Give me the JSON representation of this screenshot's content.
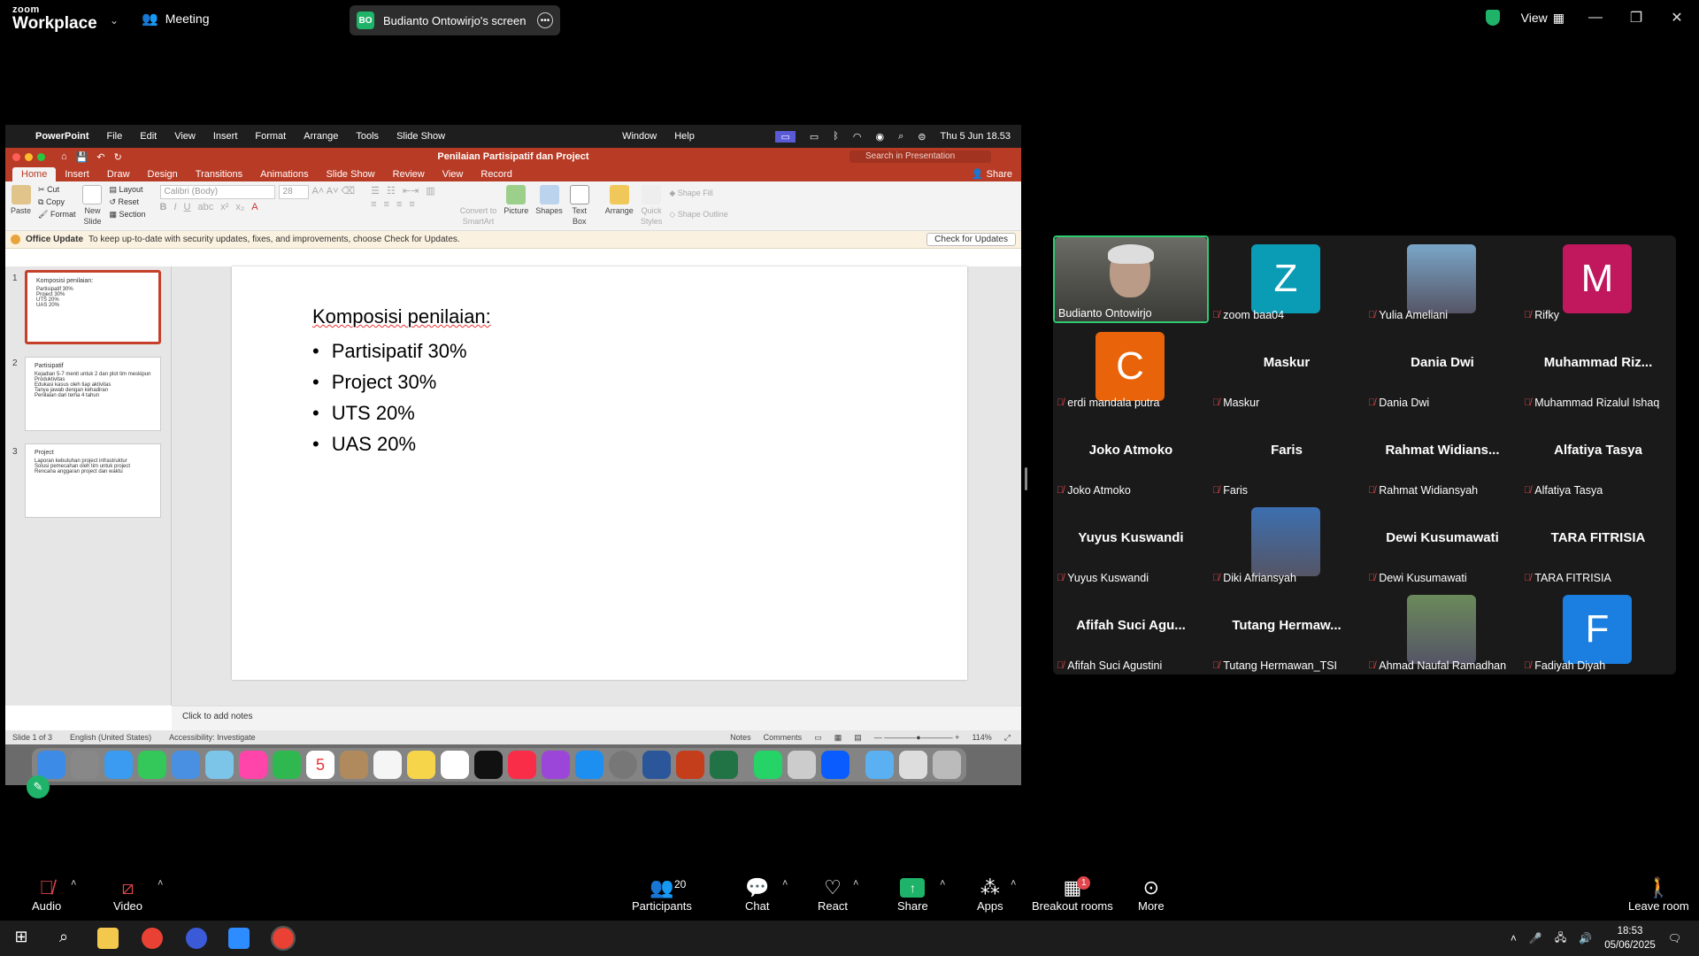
{
  "zoom": {
    "logo_top": "zoom",
    "logo_bottom": "Workplace",
    "meeting_label": "Meeting",
    "share_initials": "BO",
    "share_label": "Budianto Ontowirjo's screen",
    "view_label": "View",
    "accent": "#1fb36a"
  },
  "mac": {
    "app": "PowerPoint",
    "menus": [
      "File",
      "Edit",
      "View",
      "Insert",
      "Format",
      "Arrange",
      "Tools",
      "Slide Show"
    ],
    "menus_right": [
      "Window",
      "Help"
    ],
    "datetime": "Thu 5 Jun  18.53"
  },
  "ppt": {
    "doc_title": "Penilaian Partisipatif dan Project",
    "search_placeholder": "Search in Presentation",
    "share_label": "Share",
    "tabs": [
      "Home",
      "Insert",
      "Draw",
      "Design",
      "Transitions",
      "Animations",
      "Slide Show",
      "Review",
      "View",
      "Record"
    ],
    "brand_color": "#b83b26",
    "ribbon": {
      "paste": "Paste",
      "cut": "Cut",
      "copy": "Copy",
      "format": "Format",
      "new_slide_1": "New",
      "new_slide_2": "Slide",
      "layout": "Layout",
      "reset": "Reset",
      "section": "Section",
      "font": "Calibri (Body)",
      "size": "28",
      "convert_1": "Convert to",
      "convert_2": "SmartArt",
      "picture": "Picture",
      "shapes": "Shapes",
      "textbox_1": "Text",
      "textbox_2": "Box",
      "arrange": "Arrange",
      "quick_1": "Quick",
      "quick_2": "Styles",
      "shape_fill": "Shape Fill",
      "shape_outline": "Shape Outline"
    },
    "update_title": "Office Update",
    "update_text": "To keep up-to-date with security updates, fixes, and improvements, choose Check for Updates.",
    "check_btn": "Check for Updates",
    "thumbs": [
      {
        "num": "1",
        "title": "Komposisi penilaian:",
        "lines": [
          "Partisipatif 30%",
          "Project 30%",
          "UTS 20%",
          "UAS 20%"
        ]
      },
      {
        "num": "2",
        "title": "Partisipatif",
        "lines": [
          "Kejadian 5-7 menit untuk 2 dan plot tim meskipun",
          "Produktivitas",
          "Edukasi kasus oleh tiap aktivitas",
          "Tanya jawab dengan kehadiran",
          "Penilaian dari tema 4 tahun"
        ]
      },
      {
        "num": "3",
        "title": "Project",
        "lines": [
          "Laporan kebutuhan project infrastruktur",
          "Solusi pemecahan oleh tim untuk project",
          "Rencana anggaran project dan waktu"
        ]
      }
    ],
    "slide_title": "Komposisi penilaian:",
    "slide_bullets": [
      "Partisipatif 30%",
      "Project 30%",
      "UTS 20%",
      "UAS 20%"
    ],
    "notes_placeholder": "Click to add notes",
    "status_slide": "Slide 1 of 3",
    "status_lang": "English (United States)",
    "status_access": "Accessibility: Investigate",
    "status_notes": "Notes",
    "status_comments": "Comments",
    "zoom_level": "114%",
    "dock_date": "5"
  },
  "participants": [
    {
      "center": "",
      "label": "Budianto Ontowirjo",
      "muted": false,
      "kind": "video"
    },
    {
      "center": "",
      "label": "zoom baa04",
      "muted": true,
      "kind": "avatar",
      "letter": "Z",
      "color": "#0a9bb5"
    },
    {
      "center": "",
      "label": "Yulia Ameliani",
      "muted": true,
      "kind": "photo",
      "color": "#7aa6c8"
    },
    {
      "center": "",
      "label": "Rifky",
      "muted": true,
      "kind": "avatar",
      "letter": "M",
      "color": "#c0175d"
    },
    {
      "center": "",
      "label": "erdi mandala putra",
      "muted": true,
      "kind": "avatar",
      "letter": "C",
      "color": "#e8630a"
    },
    {
      "center": "Maskur",
      "label": "Maskur",
      "muted": true,
      "kind": "name"
    },
    {
      "center": "Dania Dwi",
      "label": "Dania Dwi",
      "muted": true,
      "kind": "name"
    },
    {
      "center": "Muhammad  Riz...",
      "label": "Muhammad Rizalul Ishaq",
      "muted": true,
      "kind": "name"
    },
    {
      "center": "Joko Atmoko",
      "label": "Joko Atmoko",
      "muted": true,
      "kind": "name"
    },
    {
      "center": "Faris",
      "label": "Faris",
      "muted": true,
      "kind": "name"
    },
    {
      "center": "Rahmat  Widians...",
      "label": "Rahmat Widiansyah",
      "muted": true,
      "kind": "name"
    },
    {
      "center": "Alfatiya Tasya",
      "label": "Alfatiya Tasya",
      "muted": true,
      "kind": "name"
    },
    {
      "center": "Yuyus Kuswandi",
      "label": "Yuyus Kuswandi",
      "muted": true,
      "kind": "name"
    },
    {
      "center": "",
      "label": "Diki Afriansyah",
      "muted": true,
      "kind": "photo",
      "color": "#3c6fb0"
    },
    {
      "center": "Dewi Kusumawati",
      "label": "Dewi Kusumawati",
      "muted": true,
      "kind": "name"
    },
    {
      "center": "TARA FITRISIA",
      "label": "TARA FITRISIA",
      "muted": true,
      "kind": "name"
    },
    {
      "center": "Afifah  Suci  Agu...",
      "label": "Afifah Suci Agustini",
      "muted": true,
      "kind": "name"
    },
    {
      "center": "Tutang  Hermaw...",
      "label": "Tutang Hermawan_TSI",
      "muted": true,
      "kind": "name"
    },
    {
      "center": "",
      "label": "Ahmad Naufal Ramadhan",
      "muted": true,
      "kind": "photo",
      "color": "#6b8a5a"
    },
    {
      "center": "",
      "label": "Fadiyah Diyah",
      "muted": true,
      "kind": "avatar",
      "letter": "F",
      "color": "#1a7fe0"
    }
  ],
  "toolbar": {
    "audio": "Audio",
    "video": "Video",
    "participants": "Participants",
    "participants_count": "20",
    "chat": "Chat",
    "react": "React",
    "share": "Share",
    "apps": "Apps",
    "breakout": "Breakout rooms",
    "breakout_badge": "1",
    "more": "More",
    "leave": "Leave room"
  },
  "taskbar": {
    "time": "18:53",
    "date": "05/06/2025"
  }
}
